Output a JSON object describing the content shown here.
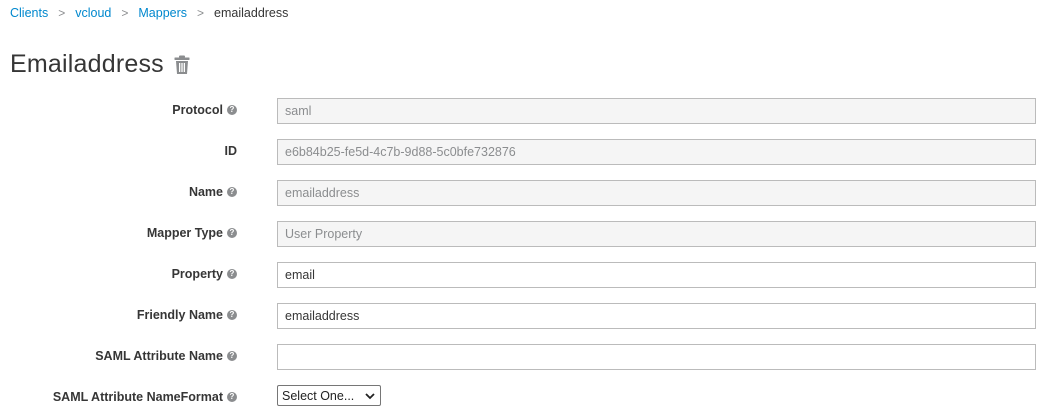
{
  "breadcrumb": {
    "items": [
      "Clients",
      "vcloud",
      "Mappers"
    ],
    "current": "emailaddress",
    "separator": ">"
  },
  "page": {
    "title": "Emailaddress"
  },
  "form": {
    "protocol": {
      "label": "Protocol",
      "value": "saml"
    },
    "id": {
      "label": "ID",
      "value": "e6b84b25-fe5d-4c7b-9d88-5c0bfe732876"
    },
    "name": {
      "label": "Name",
      "value": "emailaddress"
    },
    "mapper_type": {
      "label": "Mapper Type",
      "value": "User Property"
    },
    "property": {
      "label": "Property",
      "value": "email"
    },
    "friendly_name": {
      "label": "Friendly Name",
      "value": "emailaddress"
    },
    "saml_attribute_name": {
      "label": "SAML Attribute Name",
      "value": ""
    },
    "saml_attribute_nameformat": {
      "label": "SAML Attribute NameFormat",
      "selected": "Select One..."
    }
  },
  "help_glyph": "?",
  "colors": {
    "link": "#0088ce",
    "readonly_bg": "#f5f5f5",
    "help_icon": "#8b8d8f"
  }
}
